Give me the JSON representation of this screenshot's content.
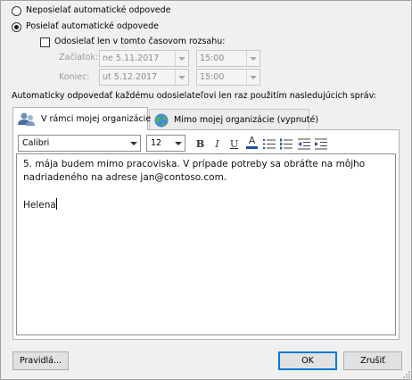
{
  "options": {
    "no_reply_label": "Neposielať automatické odpovede",
    "send_reply_label": "Posielať automatické odpovede",
    "time_range_label": "Odosielať len v tomto časovom rozsahu:"
  },
  "range": {
    "start_label": "Začiatok:",
    "start_date": "ne 5.11.2017",
    "start_time": "15:00",
    "end_label": "Koniec:",
    "end_date": "ut 5.12.2017",
    "end_time": "15:00"
  },
  "instruction": "Automaticky odpovedať každému odosielateľovi len raz použitím nasledujúcich správ:",
  "tabs": [
    {
      "label": "V rámci mojej organizácie",
      "active": true
    },
    {
      "label": "Mimo mojej organizácie (vypnuté)",
      "active": false
    }
  ],
  "format": {
    "font": "Calibri",
    "size": "12",
    "bold": "B",
    "italic": "I",
    "underline": "U",
    "font_color": "A"
  },
  "message": {
    "line1": "5. mája budem mimo pracoviska. V prípade potreby sa obráťte na môjho",
    "line2": "nadriadeného na adrese jan@contoso.com.",
    "signature": "Helena"
  },
  "buttons": {
    "rules": "Pravidlá...",
    "ok": "OK",
    "cancel": "Zrušiť"
  },
  "colors": {
    "accent": "#0078d7",
    "font_color_bar": "#1f4e99"
  }
}
